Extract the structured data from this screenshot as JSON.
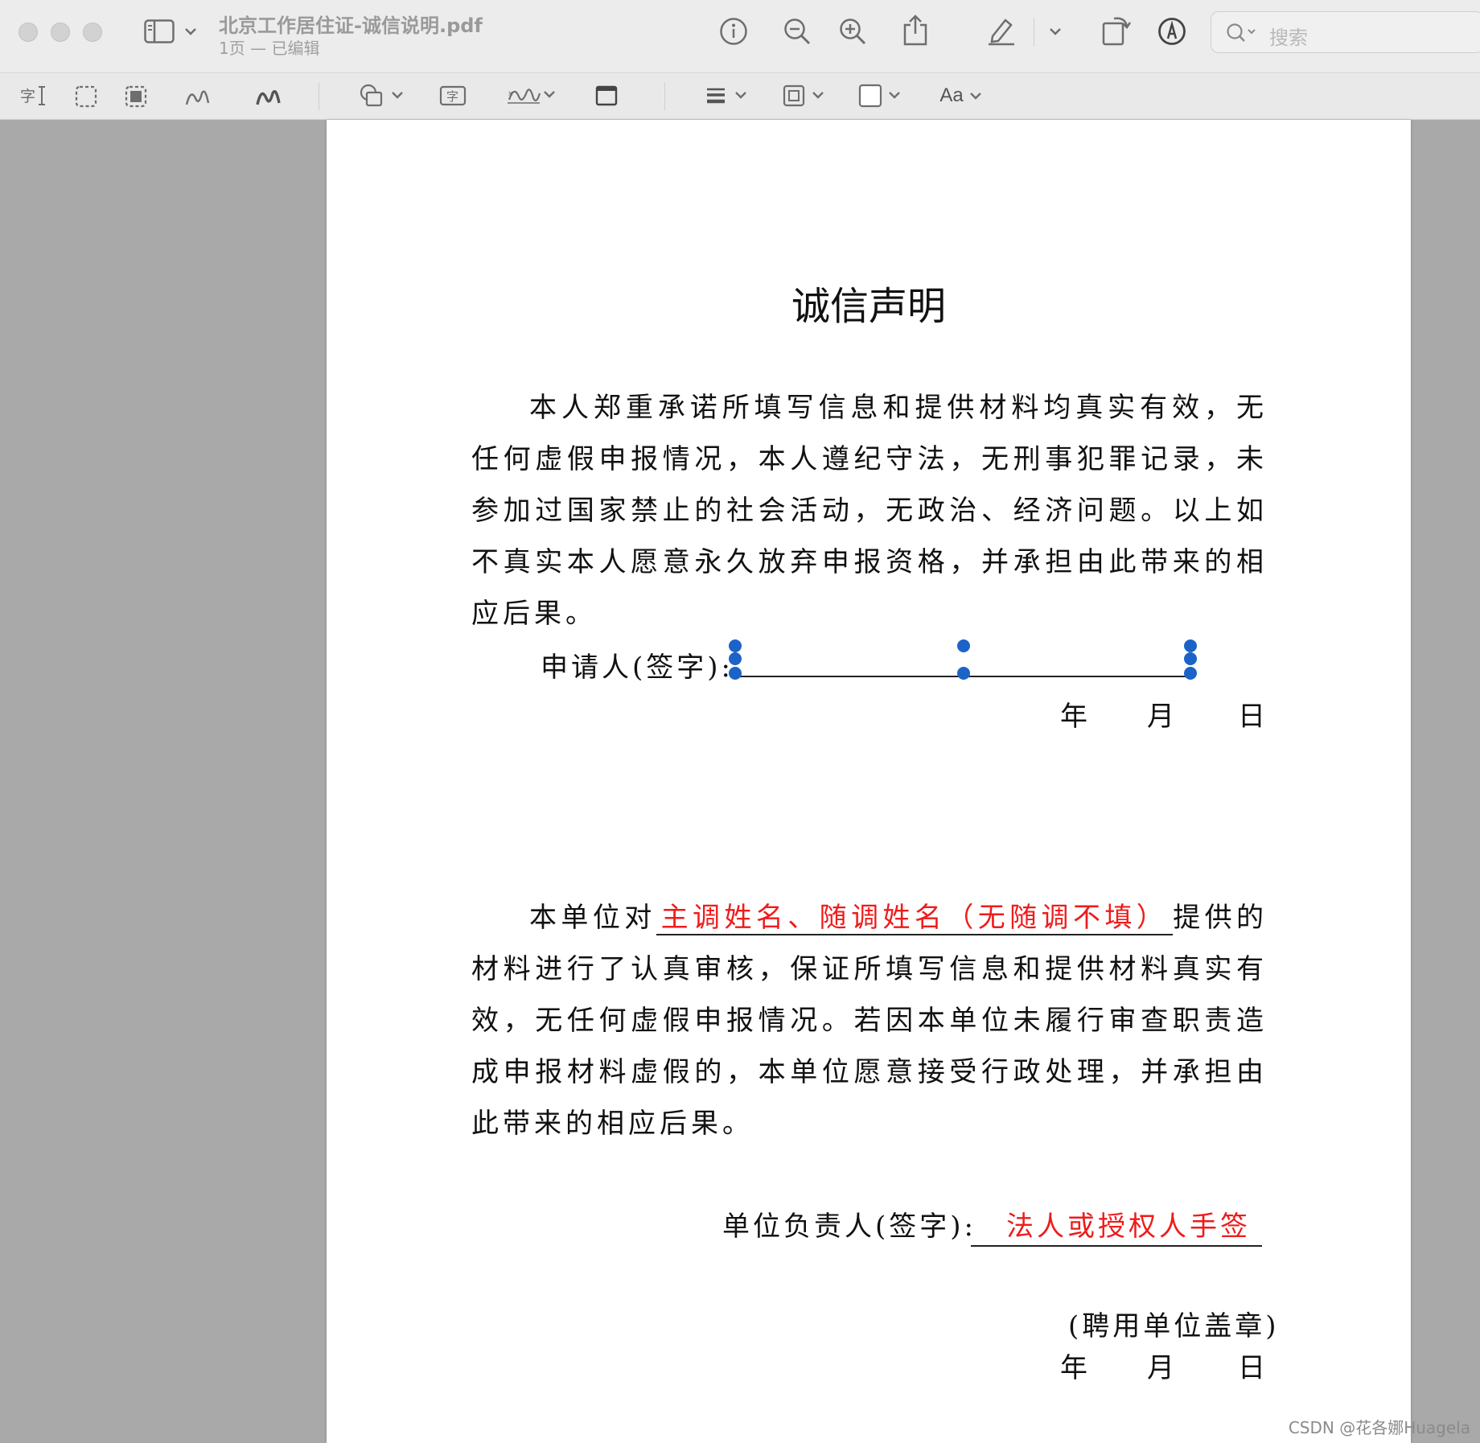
{
  "window": {
    "document_title": "北京工作居住证-诚信说明.pdf",
    "subtitle": "1页 — 已编辑"
  },
  "toolbar": {
    "search_placeholder": "搜索",
    "icons": [
      "sidebar-icon",
      "info-icon",
      "zoom-out-icon",
      "zoom-in-icon",
      "share-icon",
      "highlight-pen-icon",
      "rotate-icon",
      "markup-icon",
      "search-icon"
    ]
  },
  "markup_toolbar": {
    "text_style_label": "Aa",
    "icons": [
      "text-selection-icon",
      "rect-selection-icon",
      "smart-lasso-icon",
      "sketch-icon",
      "draw-icon",
      "shapes-icon",
      "text-box-icon",
      "sign-icon",
      "note-icon",
      "line-style-icon",
      "border-color-icon",
      "fill-color-icon",
      "text-style-icon"
    ]
  },
  "document": {
    "heading": "诚信声明",
    "para1": "本人郑重承诺所填写信息和提供材料均真实有效，无任何虚假申报情况，本人遵纪守法，无刑事犯罪记录，未参加过国家禁止的社会活动，无政治、经济问题。以上如不真实本人愿意永久放弃申报资格，并承担由此带来的相应后果。",
    "applicant_label": "申请人(签字):",
    "date_year": "年",
    "date_month": "月",
    "date_day": "日",
    "para2_prefix": "本单位对",
    "para2_red": "主调姓名、随调姓名（无随调不填）",
    "para2_rest": "提供的材料进行了认真审核，保证所填写信息和提供材料真实有效，无任何虚假申报情况。若因本单位未履行审查职责造成申报材料虚假的，本单位愿意接受行政处理，并承担由此带来的相应后果。",
    "unit_head_label": "单位负责人(签字):",
    "unit_head_red": "法人或授权人手签",
    "seal_label": "(聘用单位盖章)"
  },
  "watermark": "CSDN @花各娜Huagela",
  "colors": {
    "accent_red": "#ee1c1c",
    "handle_blue": "#1c63c8"
  }
}
